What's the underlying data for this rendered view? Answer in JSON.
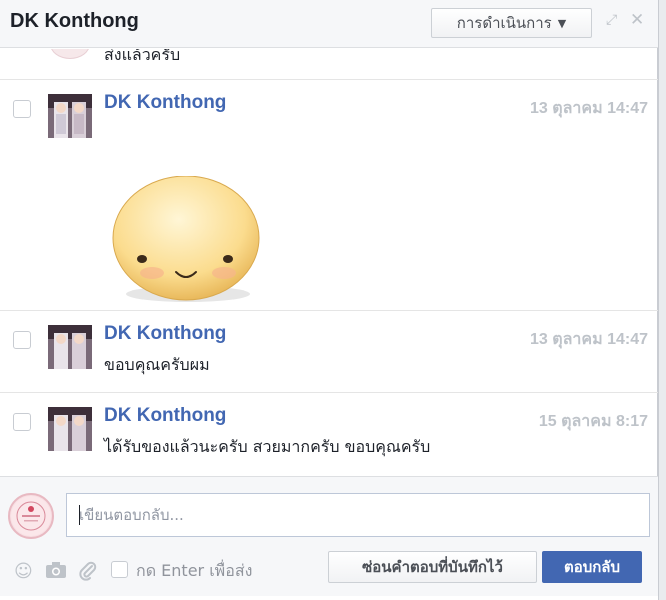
{
  "window": {
    "title": "DK Konthong",
    "actions_label": "การดำเนินการ",
    "expand_icon": "expand-icon",
    "close_icon": "close-icon"
  },
  "conversation": {
    "partial_message": "ส่งแล้วครับ",
    "messages": [
      {
        "sender": "DK Konthong",
        "time": "13 ตุลาคม 14:47",
        "text": "",
        "has_sticker": true
      },
      {
        "sender": "DK Konthong",
        "time": "13 ตุลาคม 14:47",
        "text": "ขอบคุณครับผม"
      },
      {
        "sender": "DK Konthong",
        "time": "15 ตุลาคม 8:17",
        "text": "ได้รับของแล้วนะครับ สวยมากครับ ขอบคุณครับ"
      }
    ]
  },
  "composer": {
    "placeholder": "เขียนตอบกลับ...",
    "enter_to_send_label": "กด Enter เพื่อส่ง",
    "save_reply_label": "ซ่อนคำตอบที่บันทึกไว้",
    "reply_label": "ตอบกลับ"
  },
  "colors": {
    "accent": "#4267b2",
    "sender": "#4267b2",
    "muted": "#bec3c9"
  }
}
